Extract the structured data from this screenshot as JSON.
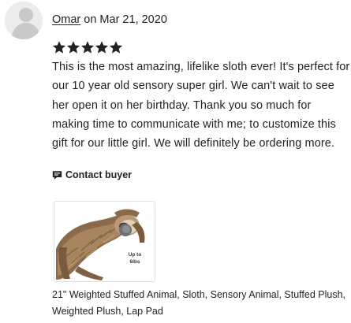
{
  "review": {
    "reviewer_name": "Omar",
    "date_text": " on Mar 21, 2020",
    "rating": 5,
    "rating_max": 5,
    "text": "This is the most amazing, lifelike sloth ever! It's perfect for our 10 year old sensory super girl. We can't wait to see her open it on her birthday. Thank you so much for making time to communicate with me; to customize this gift for our little girl. We will definitely be ordering more.",
    "contact_label": "Contact buyer",
    "contact_icon": "speech-bubble-icon",
    "avatar_icon": "default-user-avatar-icon"
  },
  "product": {
    "thumb_badge": "Up to\n6lbs",
    "title": "21\" Weighted Stuffed Animal, Sloth, Sensory Animal, Stuffed Plush, Weighted Plush, Lap Pad"
  },
  "colors": {
    "text": "#222222",
    "star": "#222222",
    "avatar_bg": "#e9e9e9",
    "avatar_fg": "#c4c4c4"
  }
}
